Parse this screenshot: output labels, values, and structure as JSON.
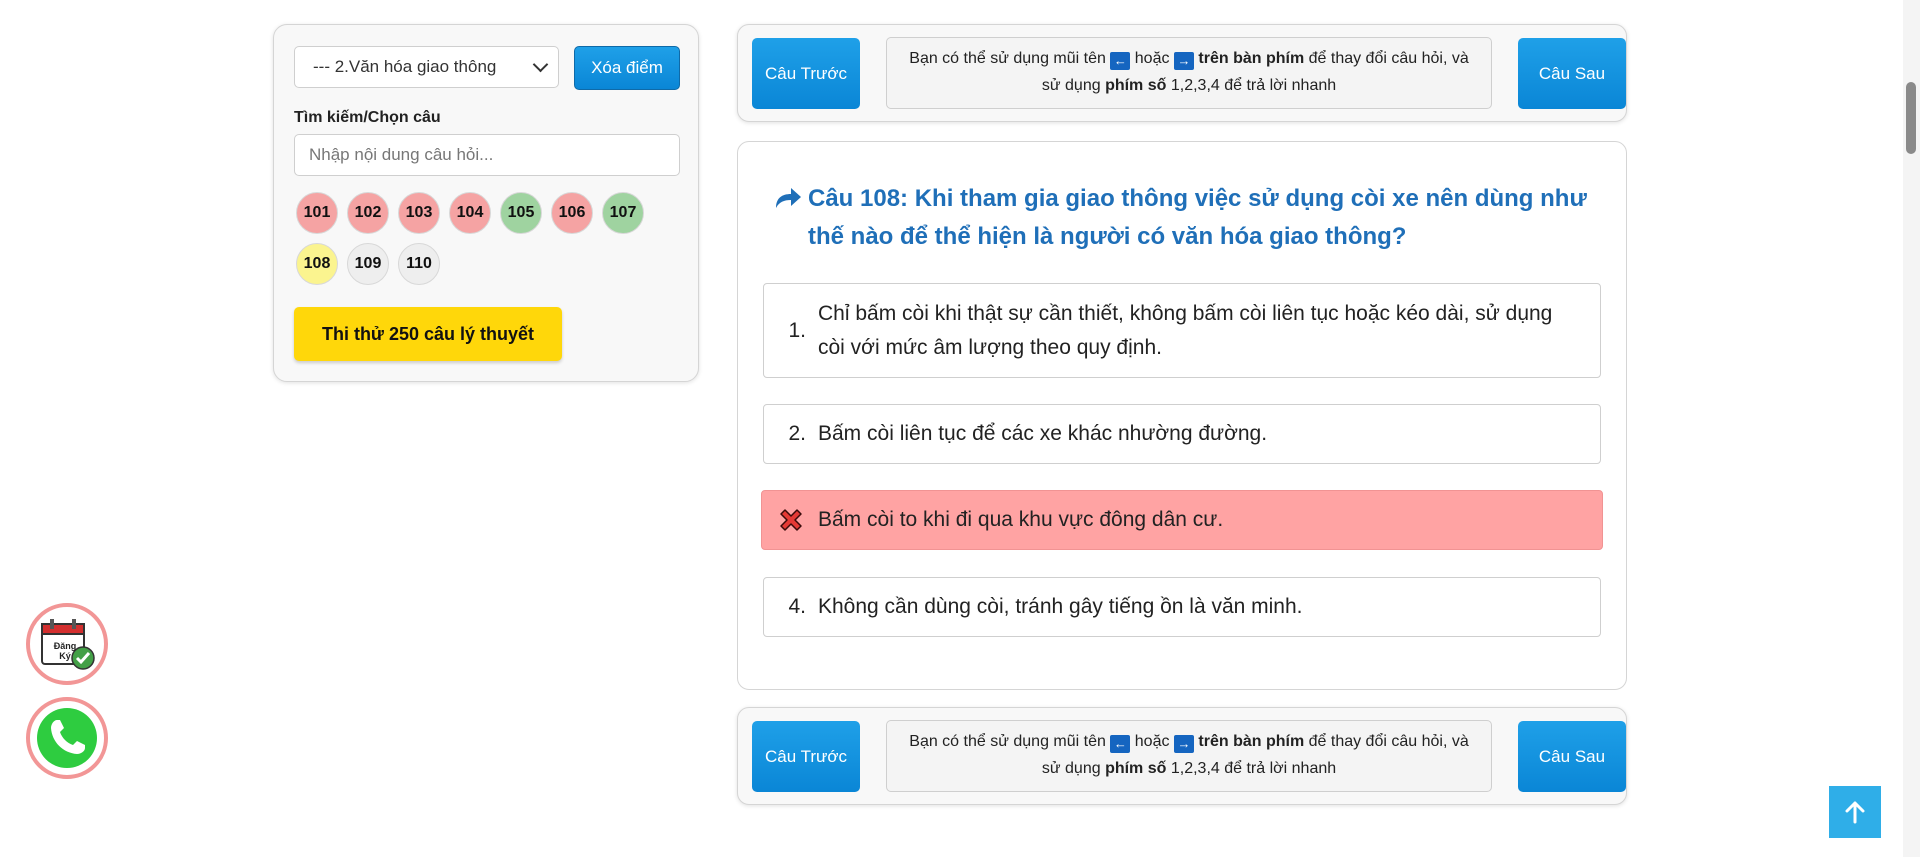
{
  "sidebar": {
    "topic_select": "--- 2.Văn hóa giao thông",
    "clear_button": "Xóa điểm",
    "search_label": "Tìm kiếm/Chọn câu",
    "search_placeholder": "Nhập nội dung câu hỏi...",
    "questions": [
      {
        "label": "101",
        "status": "wrong",
        "color": "#f5a3a3"
      },
      {
        "label": "102",
        "status": "wrong",
        "color": "#f5a3a3"
      },
      {
        "label": "103",
        "status": "wrong",
        "color": "#f5a3a3"
      },
      {
        "label": "104",
        "status": "wrong",
        "color": "#f5a3a3"
      },
      {
        "label": "105",
        "status": "correct",
        "color": "#9fd3a0"
      },
      {
        "label": "106",
        "status": "wrong",
        "color": "#f5a3a3"
      },
      {
        "label": "107",
        "status": "correct",
        "color": "#9fd3a0"
      },
      {
        "label": "108",
        "status": "current",
        "color": "#fbf48f"
      },
      {
        "label": "109",
        "status": "unanswered",
        "color": "#eeeeee"
      },
      {
        "label": "110",
        "status": "unanswered",
        "color": "#eeeeee"
      }
    ],
    "trial_button": "Thi thử 250 câu lý thuyết"
  },
  "nav_top": {
    "prev": "Câu Trước",
    "next": "Câu Sau",
    "hint_1": "Bạn có thể sử dụng mũi tên",
    "hint_or": "hoặc",
    "hint_keyboard": "trên bàn phím",
    "hint_2": "để thay đổi câu hỏi, và",
    "hint_3": "sử dụng",
    "hint_numkeys": "phím số",
    "hint_4": "1,2,3,4 để trả lời nhanh"
  },
  "question": {
    "title": "Câu 108: Khi tham gia giao thông việc sử dụng còi xe nên dùng như thế nào để thể hiện là người có văn hóa giao thông?",
    "answers": [
      {
        "num": "1.",
        "text": "Chỉ bấm còi khi thật sự cần thiết, không bấm còi liên tục hoặc kéo dài, sử dụng còi với mức âm lượng theo quy định."
      },
      {
        "num": "2.",
        "text": "Bấm còi liên tục để các xe khác nhường đường."
      },
      {
        "num": "",
        "text": "Bấm còi to khi đi qua khu vực đông dân cư.",
        "state": "wrong-selected"
      },
      {
        "num": "4.",
        "text": "Không cần dùng còi, tránh gây tiếng ồn là văn minh."
      }
    ]
  },
  "floating": {
    "register_icon": "calendar-check-icon",
    "register_text_1": "Đăng",
    "register_text_2": "Ký",
    "phone_icon": "phone-icon"
  },
  "colors": {
    "primary": "#0a86d6",
    "title_blue": "#1f6fb8",
    "wrong_bg": "#ffa3a3",
    "trial_yellow": "#ffd70a"
  }
}
